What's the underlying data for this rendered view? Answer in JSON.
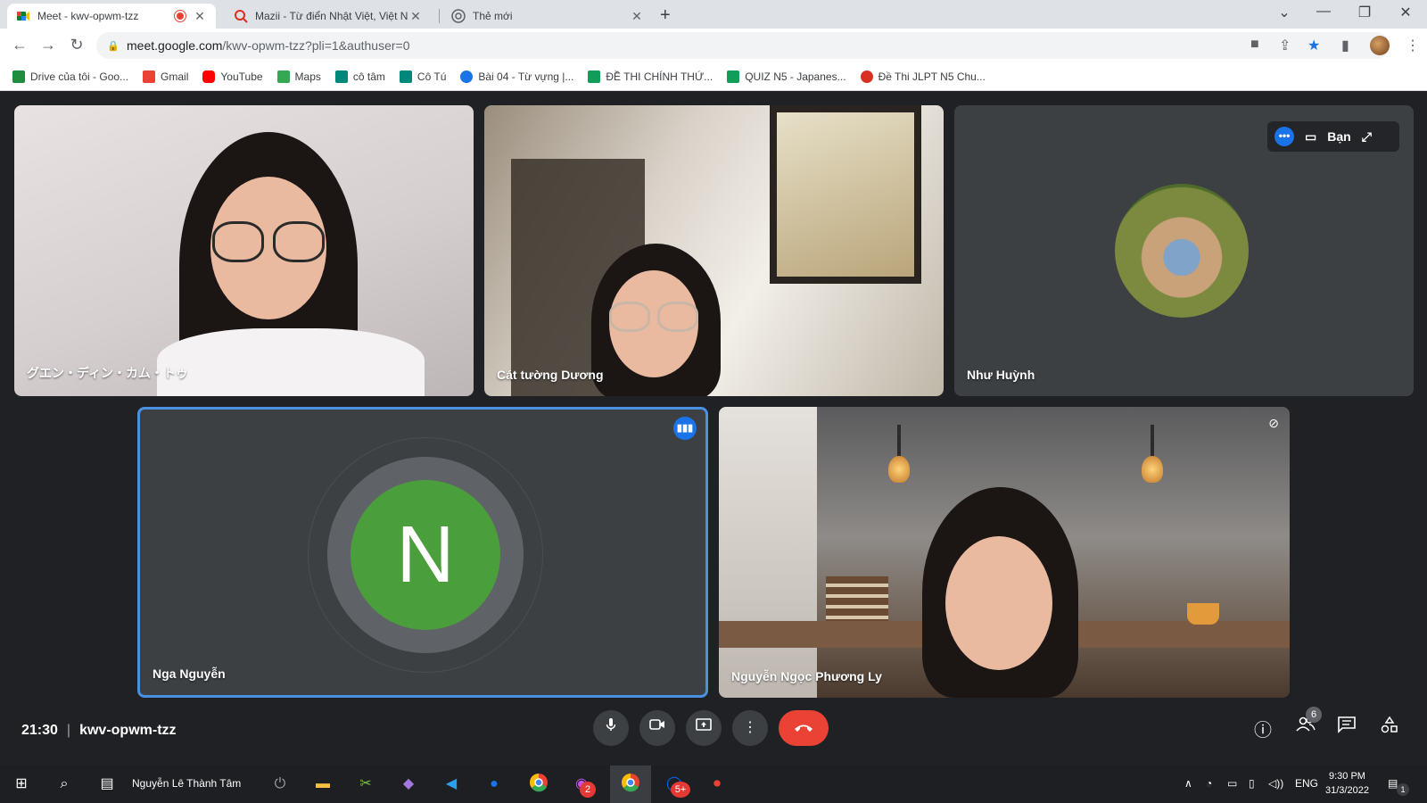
{
  "browser": {
    "tabs": [
      {
        "title": "Meet - kwv-opwm-tzz",
        "favicon": "google-meet-icon",
        "recording": true
      },
      {
        "title": "Mazii - Từ điển Nhật Việt, Việt Nh",
        "favicon": "mazii-icon"
      },
      {
        "title": "Thẻ mới",
        "favicon": "chrome-icon"
      }
    ],
    "url": {
      "host": "meet.google.com",
      "path": "/kwv-opwm-tzz?pli=1&authuser=0"
    },
    "bookmarks": [
      {
        "label": "Drive của tôi - Goo...",
        "icon": "google-drive-icon",
        "color": "#1e8e3e"
      },
      {
        "label": "Gmail",
        "icon": "gmail-icon",
        "color": "#ea4335"
      },
      {
        "label": "YouTube",
        "icon": "youtube-icon",
        "color": "#ff0000"
      },
      {
        "label": "Maps",
        "icon": "maps-icon",
        "color": "#34a853"
      },
      {
        "label": "cô tâm",
        "icon": "google-meet-icon",
        "color": "#00897b"
      },
      {
        "label": "Cô Tú",
        "icon": "google-meet-icon",
        "color": "#00897b"
      },
      {
        "label": "Bài 04 - Từ vựng |...",
        "icon": "site-icon",
        "color": "#1a73e8"
      },
      {
        "label": "ĐỀ THI CHÍNH THỨ...",
        "icon": "sheets-icon",
        "color": "#0f9d58"
      },
      {
        "label": "QUIZ N5 - Japanes...",
        "icon": "sheets-icon",
        "color": "#0f9d58"
      },
      {
        "label": "Đề Thi JLPT N5 Chu...",
        "icon": "site-icon",
        "color": "#d93025"
      }
    ]
  },
  "meeting": {
    "time": "21:30",
    "code": "kwv-opwm-tzz",
    "participants_count": "6",
    "self_panel_label": "Bạn"
  },
  "participants": [
    {
      "name": "グエン・ディン・カム・トゥ"
    },
    {
      "name": "Cát tường Dương"
    },
    {
      "name": "Như Huỳnh"
    },
    {
      "name": "Nga Nguyễn",
      "initial": "N"
    },
    {
      "name": "Nguyễn Ngọc Phương Ly"
    }
  ],
  "taskbar": {
    "user": "Nguyễn Lê Thành Tâm",
    "lang": "ENG",
    "time": "9:30 PM",
    "date": "31/3/2022",
    "notifications": "1",
    "badge_messenger": "2",
    "badge_zalo": "5+"
  },
  "colors": {
    "accent": "#1a73e8",
    "end_call": "#ea4335",
    "avatar_n": "#4b9e3c",
    "dark_bg": "#202124"
  }
}
